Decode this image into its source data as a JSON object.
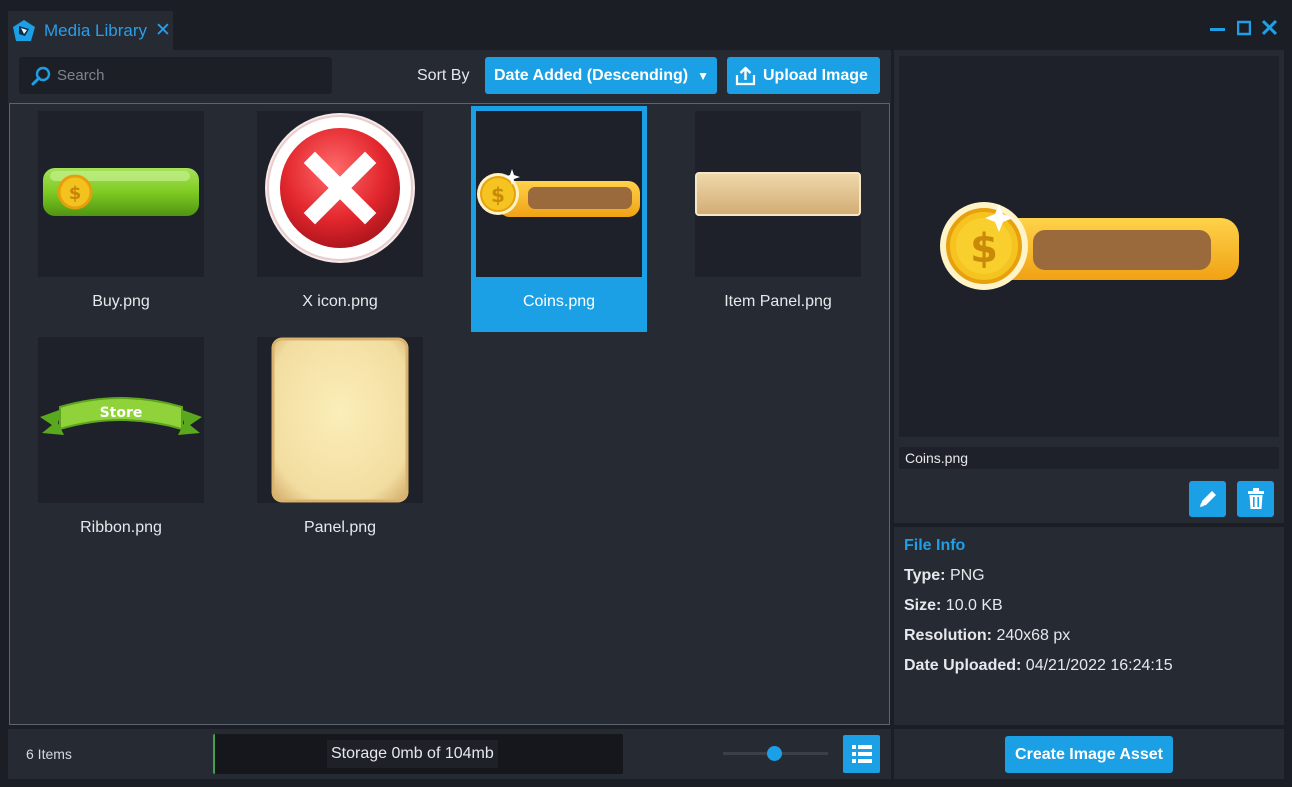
{
  "window": {
    "tab_title": "Media Library",
    "close_glyph": "✕",
    "controls": [
      "minimize-icon",
      "maximize-icon",
      "close-icon"
    ]
  },
  "toolbar": {
    "search_placeholder": "Search",
    "sort_label": "Sort By",
    "sort_value": "Date Added (Descending)",
    "upload_label": "Upload Image"
  },
  "assets": [
    {
      "name": "Buy.png",
      "selected": false
    },
    {
      "name": "X icon.png",
      "selected": false
    },
    {
      "name": "Coins.png",
      "selected": true
    },
    {
      "name": "Item Panel.png",
      "selected": false
    },
    {
      "name": "Ribbon.png",
      "selected": false
    },
    {
      "name": "Panel.png",
      "selected": false
    }
  ],
  "footer": {
    "item_count": "6 Items",
    "storage_text": "Storage 0mb of 104mb"
  },
  "details": {
    "filename": "Coins.png",
    "file_info_title": "File Info",
    "type_label": "Type:",
    "type_value": "PNG",
    "size_label": "Size:",
    "size_value": "10.0 KB",
    "resolution_label": "Resolution:",
    "resolution_value": "240x68 px",
    "date_label": "Date Uploaded:",
    "date_value": "04/21/2022 16:24:15",
    "create_label": "Create Image Asset"
  },
  "colors": {
    "accent": "#1ba0e6",
    "panel": "#262a33",
    "background": "#1b1e25"
  }
}
